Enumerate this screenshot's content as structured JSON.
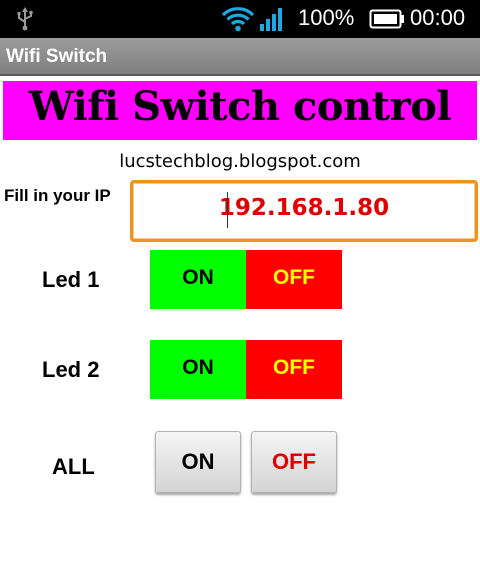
{
  "status_bar": {
    "usb_icon": "usb-icon",
    "wifi_icon": "wifi-icon",
    "signal_icon": "signal-icon",
    "battery_percent": "100%",
    "battery_icon": "battery-icon",
    "time": "00:00",
    "accent_color": "#1ea7e0"
  },
  "title_bar": {
    "title": "Wifi Switch"
  },
  "banner": {
    "text": "Wifi Switch control",
    "background": "#ff00ff"
  },
  "subtitle": "lucstechblog.blogspot.com",
  "ip": {
    "label": "Fill in your IP",
    "value": "192.168.1.80",
    "border_color": "#f0921e",
    "text_color": "#e00000"
  },
  "rows": [
    {
      "label": "Led 1",
      "on_label": "ON",
      "off_label": "OFF"
    },
    {
      "label": "Led 2",
      "on_label": "ON",
      "off_label": "OFF"
    },
    {
      "label": "ALL",
      "on_label": "ON",
      "off_label": "OFF"
    }
  ],
  "colors": {
    "on_bg": "#00ff00",
    "off_bg": "#ff0000",
    "off_text": "#ffff00"
  }
}
